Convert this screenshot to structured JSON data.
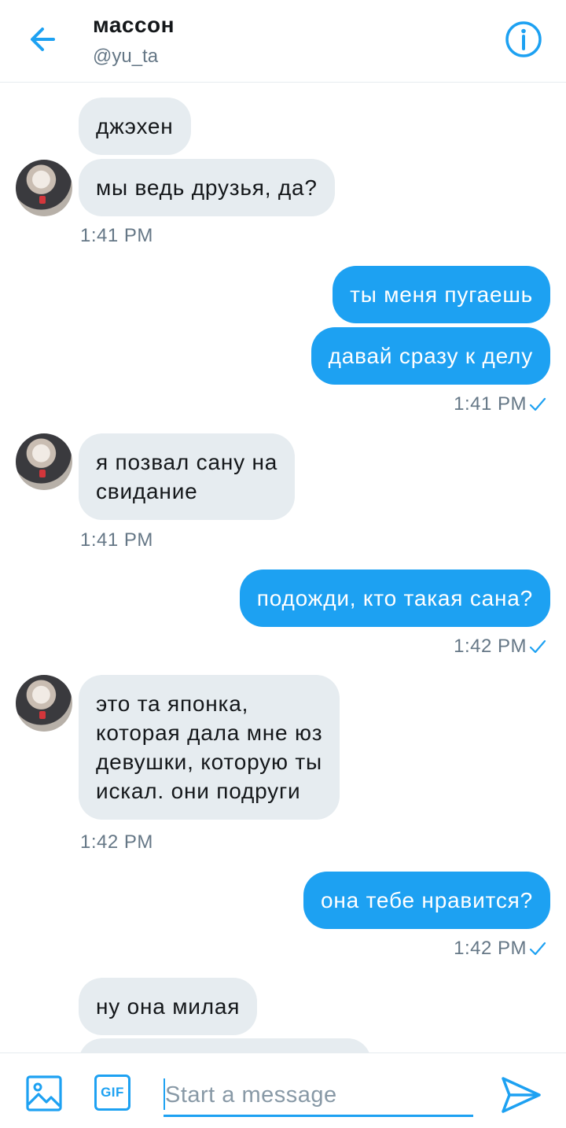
{
  "header": {
    "name": "массон",
    "handle": "@yu_ta",
    "back_icon": "arrow-left-icon",
    "info_icon": "info-icon"
  },
  "messages": [
    {
      "side": "in",
      "text": "джэхен"
    },
    {
      "side": "in",
      "text": "мы ведь друзья, да?",
      "time": "1:41 PM"
    },
    {
      "side": "out",
      "text": "ты меня пугаешь"
    },
    {
      "side": "out",
      "text": "давай сразу к делу",
      "time": "1:41 PM"
    },
    {
      "side": "in",
      "lines": [
        "я позвал сану на",
        "свидание"
      ],
      "time": "1:41 PM"
    },
    {
      "side": "out",
      "text": "подожди, кто такая сана?",
      "time": "1:42 PM"
    },
    {
      "side": "in",
      "lines": [
        "это та японка,",
        "которая дала мне юз",
        "девушки, которую ты",
        "искал. они подруги"
      ],
      "time": "1:42 PM"
    },
    {
      "side": "out",
      "text": "она тебе нравится?",
      "time": "1:42 PM"
    },
    {
      "side": "in",
      "text": "ну она милая"
    }
  ],
  "composer": {
    "placeholder": "Start a message",
    "value": "",
    "gif_label": "GIF",
    "image_icon": "image-icon",
    "send_icon": "send-icon"
  },
  "colors": {
    "accent": "#1da1f2",
    "incoming_bubble": "#e6ecf0",
    "secondary_text": "#657786"
  }
}
